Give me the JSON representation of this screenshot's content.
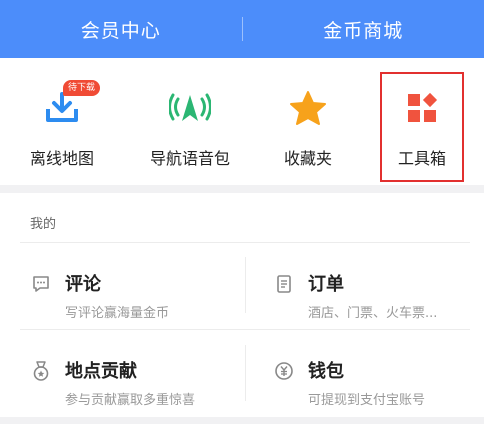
{
  "header": {
    "tabs": [
      {
        "label": "会员中心"
      },
      {
        "label": "金币商城"
      }
    ]
  },
  "quick_actions": [
    {
      "label": "离线地图",
      "icon": "download-icon",
      "badge": "待下载"
    },
    {
      "label": "导航语音包",
      "icon": "voice-broadcast-icon"
    },
    {
      "label": "收藏夹",
      "icon": "star-icon"
    },
    {
      "label": "工具箱",
      "icon": "toolbox-icon",
      "highlighted": true
    }
  ],
  "mine": {
    "title": "我的",
    "items": [
      {
        "title": "评论",
        "subtitle": "写评论赢海量金币",
        "icon": "comment-icon"
      },
      {
        "title": "订单",
        "subtitle": "酒店、门票、火车票...",
        "icon": "order-icon"
      },
      {
        "title": "地点贡献",
        "subtitle": "参与贡献赢取多重惊喜",
        "icon": "medal-icon"
      },
      {
        "title": "钱包",
        "subtitle": "可提现到支付宝账号",
        "icon": "wallet-icon"
      }
    ]
  },
  "colors": {
    "header_bg": "#4c8dfa",
    "download_blue": "#2d8cf0",
    "voice_green": "#2bb673",
    "star_orange": "#f7a21b",
    "toolbox_red": "#f0533e",
    "badge_red": "#f04b35",
    "highlight_border": "#e2302f"
  }
}
